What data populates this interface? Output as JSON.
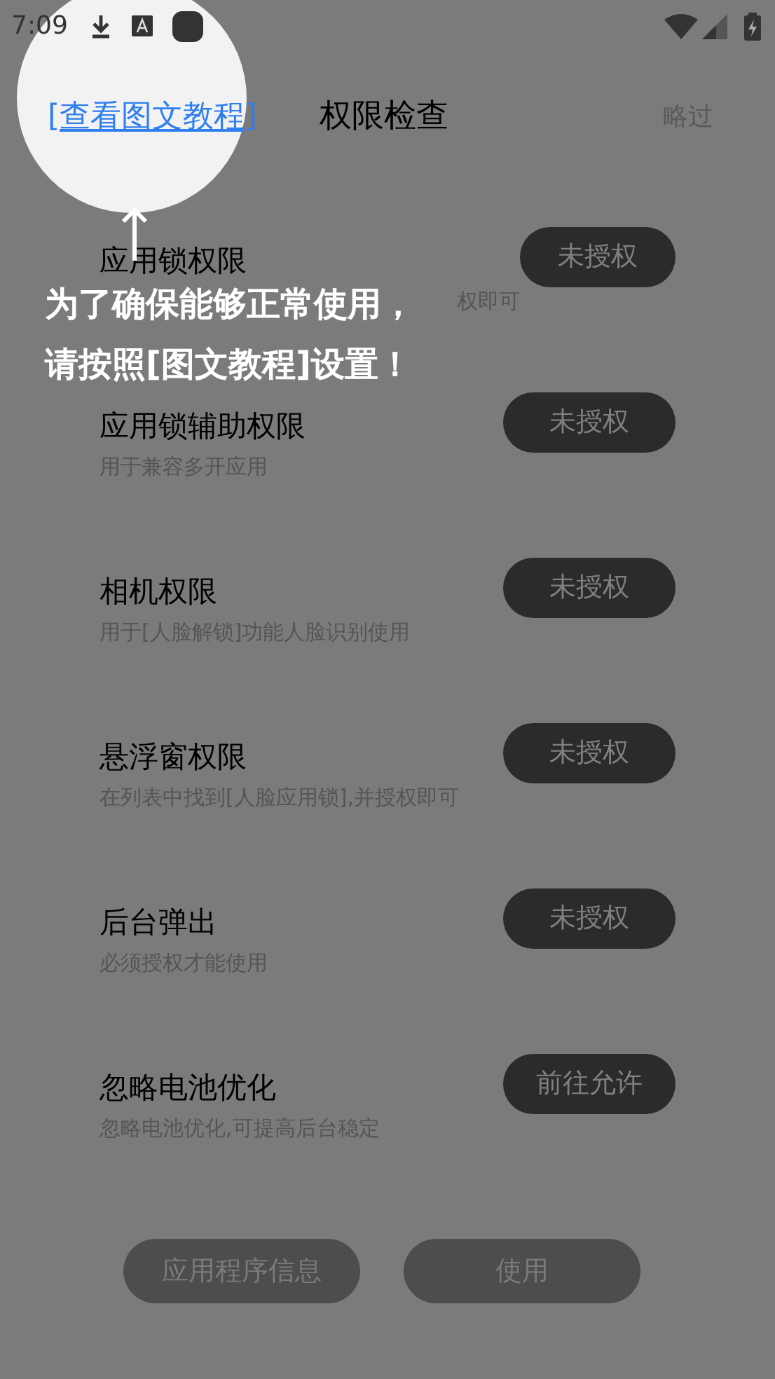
{
  "status_bar": {
    "time": "7:09"
  },
  "header": {
    "link": "[查看图文教程]",
    "title": "权限检查",
    "skip": "略过"
  },
  "permissions": [
    {
      "title": "应用锁权限",
      "subtitle": "权即可",
      "button": "未授权"
    },
    {
      "title": "应用锁辅助权限",
      "subtitle": "用于兼容多开应用",
      "button": "未授权"
    },
    {
      "title": "相机权限",
      "subtitle": "用于[人脸解锁]功能人脸识别使用",
      "button": "未授权"
    },
    {
      "title": "悬浮窗权限",
      "subtitle": "在列表中找到[人脸应用锁],并授权即可",
      "button": "未授权"
    },
    {
      "title": "后台弹出",
      "subtitle": "必须授权才能使用",
      "button": "未授权"
    },
    {
      "title": "忽略电池优化",
      "subtitle": "忽略电池优化,可提高后台稳定",
      "button": "前往允许"
    }
  ],
  "tutorial": {
    "lines": [
      "为了确保能够正常使用，",
      "请按照[图文教程]设置！"
    ]
  },
  "bottom_buttons": [
    "应用程序信息",
    "使用"
  ]
}
